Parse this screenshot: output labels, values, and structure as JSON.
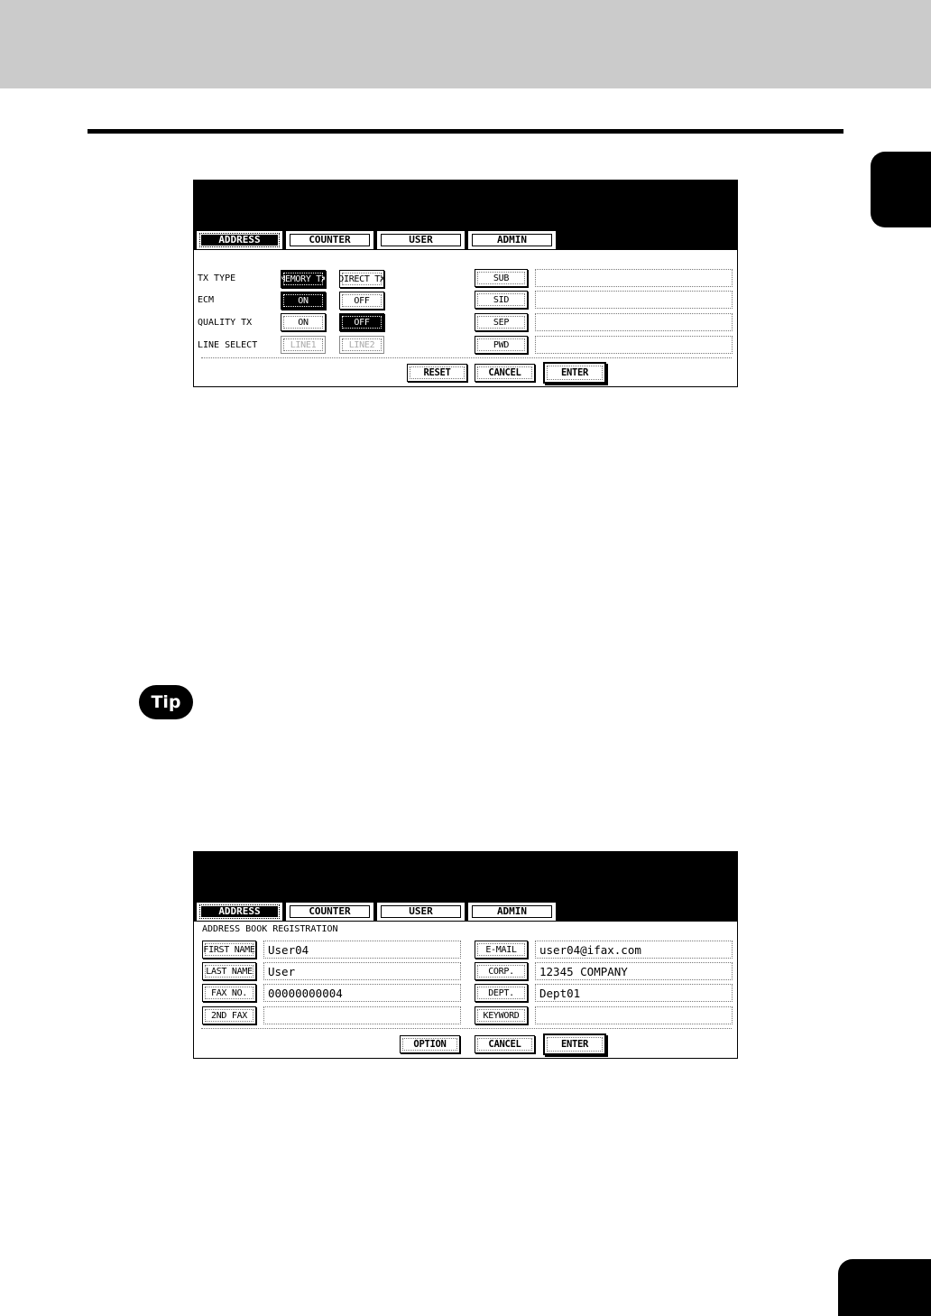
{
  "tabs": [
    "ADDRESS",
    "COUNTER",
    "USER",
    "ADMIN"
  ],
  "tip_label": "Tip",
  "screen1": {
    "tx_type_label": "TX TYPE",
    "ecm_label": "ECM",
    "quality_tx_label": "QUALITY TX",
    "line_select_label": "LINE SELECT",
    "memory_tx": "MEMORY TX",
    "direct_tx": "DIRECT TX",
    "ecm_on": "ON",
    "ecm_off": "OFF",
    "quality_on": "ON",
    "quality_off": "OFF",
    "line1": "LINE1",
    "line2": "LINE2",
    "sub": "SUB",
    "sid": "SID",
    "sep": "SEP",
    "pwd": "PWD",
    "reset": "RESET",
    "cancel": "CANCEL",
    "enter": "ENTER"
  },
  "screen2": {
    "heading": "ADDRESS BOOK REGISTRATION",
    "first_name_label": "FIRST NAME",
    "first_name_value": "User04",
    "last_name_label": "LAST NAME",
    "last_name_value": "User",
    "fax_no_label": "FAX NO.",
    "fax_no_value": "00000000004",
    "second_fax_label": "2ND FAX",
    "second_fax_value": "",
    "email_label": "E-MAIL",
    "email_value": "user04@ifax.com",
    "corp_label": "CORP.",
    "corp_value": "12345 COMPANY",
    "dept_label": "DEPT.",
    "dept_value": "Dept01",
    "keyword_label": "KEYWORD",
    "keyword_value": "",
    "option": "OPTION",
    "cancel": "CANCEL",
    "enter": "ENTER"
  }
}
